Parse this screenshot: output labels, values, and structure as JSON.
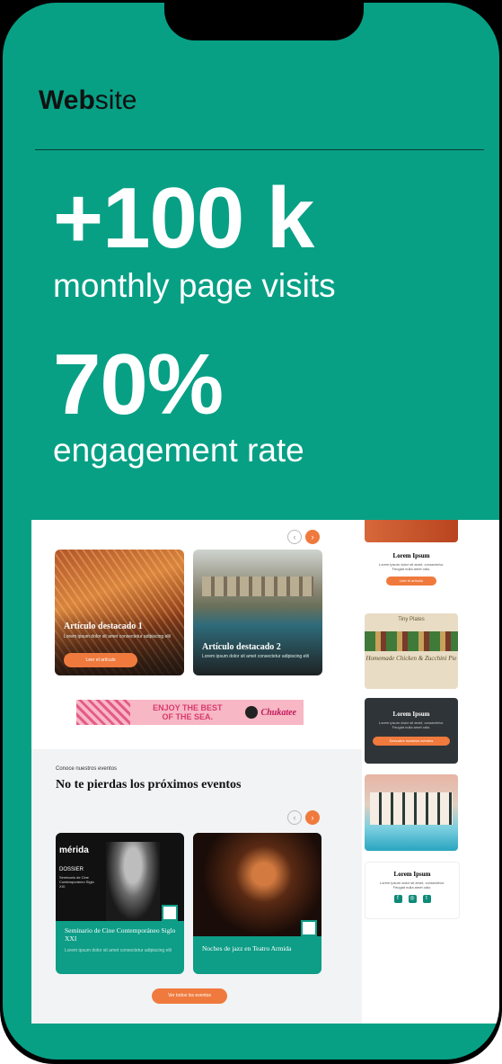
{
  "header": {
    "title_bold": "Web",
    "title_light": "site"
  },
  "stats": [
    {
      "value": "+100 k",
      "label": "monthly page visits"
    },
    {
      "value": "70%",
      "label": "engagement rate"
    }
  ],
  "preview": {
    "featured_cards": [
      {
        "title": "Artículo destacado 1",
        "subtitle": "Lorem ipsum dolor sit amet consectetur adipiscing elit",
        "button": "Leer el artículo"
      },
      {
        "title": "Artículo destacado 2",
        "subtitle": "Lorem ipsum dolor sit amet consectetur adipiscing elit",
        "button": ""
      }
    ],
    "banner": {
      "text_line1": "ENJOY THE BEST",
      "text_line2": "OF THE SEA.",
      "brand": "Chukatee"
    },
    "events_kicker": "Conoce nuestros eventos",
    "events_title": "No te pierdas los próximos eventos",
    "event_cards": [
      {
        "poster_brand": "mérida",
        "poster_label": "DOSSIER",
        "poster_text": "Seminario de Cine Contemporáneo Siglo XXI",
        "title": "Seminario de Cine Contemporáneo Siglo XXI",
        "subtitle": "Lorem ipsum dolor sit amet consectetur adipiscing elit"
      },
      {
        "title": "Noches de jazz en Teatro Armida",
        "subtitle": ""
      }
    ],
    "more_events_button": "Ver todos los eventos",
    "sidebar": {
      "card1": {
        "title": "Lorem Ipsum",
        "text": "Lorem ipsum dolor sit amet, consectetur. Feugiat nulla amet odio.",
        "button": "Leer el artículo"
      },
      "ad_label": "Tiny Plates",
      "ad_script": "Homemade Chicken & Zucchini Pie",
      "card2": {
        "title": "Lorem Ipsum",
        "text": "Lorem ipsum dolor sit amet, consectetur. Feugiat nulla amet odio.",
        "button": "Descubre nuestros eventos"
      },
      "card3": {
        "title": "Lorem Ipsum",
        "text": "Lorem ipsum dolor sit amet, consectetur. Feugiat nulla amet odio."
      }
    }
  },
  "colors": {
    "teal": "#07a085",
    "orange": "#f07a3d",
    "dark": "#000000"
  }
}
